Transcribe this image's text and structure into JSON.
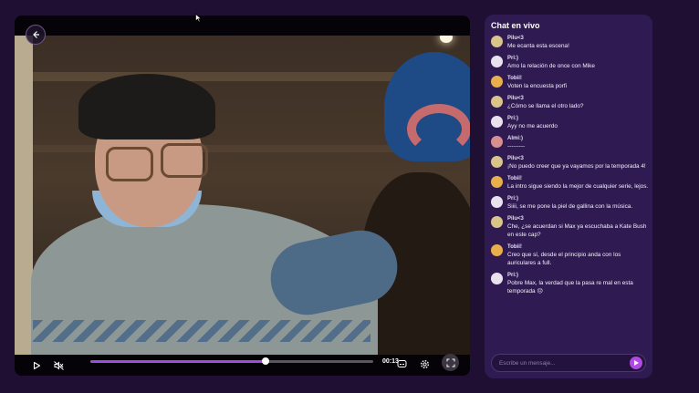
{
  "player": {
    "back_icon": "arrow-left-icon",
    "time": "00:13",
    "progress": 0.62,
    "controls": [
      "play-icon",
      "volume-muted-icon",
      "subtitles-icon",
      "settings-icon",
      "fullscreen-icon"
    ]
  },
  "chat": {
    "title": "Chat en vivo",
    "input_placeholder": "Escribe un mensaje...",
    "send_icon": "send-icon",
    "accent": "#9d4edd",
    "messages": [
      {
        "user": "Pilu<3",
        "text": "Me ecanta esta escena!",
        "avatar_color": "#d9c48a"
      },
      {
        "user": "Pri:)",
        "text": "Amo la relación de once con Mike",
        "avatar_color": "#e9e2ee"
      },
      {
        "user": "Tobii!",
        "text": "Voten la encuesta porfi",
        "avatar_color": "#e8b04c"
      },
      {
        "user": "Pilu<3",
        "text": "¿Cómo se llama el otro lado?",
        "avatar_color": "#d9c48a"
      },
      {
        "user": "Pri:)",
        "text": "Ayy no me acuerdo",
        "avatar_color": "#e9e2ee"
      },
      {
        "user": "Almi:)",
        "text": "---------",
        "avatar_color": "#d88f8f"
      },
      {
        "user": "Pilu<3",
        "text": "¡No puedo creer que ya vayamos por la temporada 4!",
        "avatar_color": "#d9c48a"
      },
      {
        "user": "Tobii!",
        "text": "La intro sigue siendo la mejor de cualquier serie, lejos.",
        "avatar_color": "#e8b04c"
      },
      {
        "user": "Pri:)",
        "text": "Siiii, se me pone la piel de gallina con la música.",
        "avatar_color": "#e9e2ee"
      },
      {
        "user": "Pilu<3",
        "text": "Che, ¿se acuerdan si Max ya escuchaba a Kate Bush en este cap?",
        "avatar_color": "#d9c48a"
      },
      {
        "user": "Tobii!",
        "text": "Creo que sí, desde el principio anda con los auriculares a full.",
        "avatar_color": "#e8b04c"
      },
      {
        "user": "Pri:)",
        "text": "Pobre Max, la verdad que la pasa re mal en esta temporada 😔",
        "avatar_color": "#e9e2ee"
      }
    ]
  }
}
